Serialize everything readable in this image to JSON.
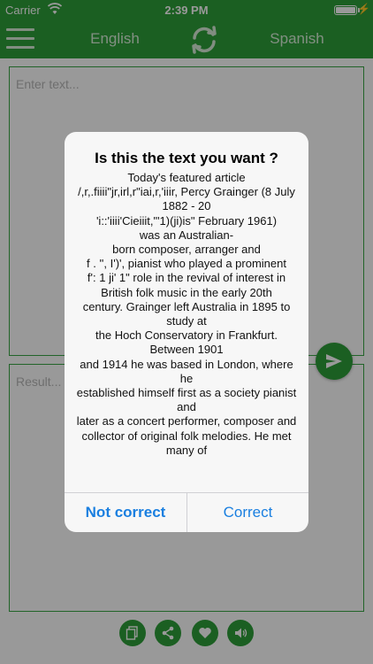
{
  "status_bar": {
    "carrier": "Carrier",
    "time": "2:39 PM"
  },
  "nav": {
    "source_language": "English",
    "target_language": "Spanish"
  },
  "input": {
    "placeholder": "Enter text..."
  },
  "result": {
    "placeholder": "Result..."
  },
  "alert": {
    "title": "Is this the text you want ?",
    "lines": [
      "Today's featured article",
      "/,r,.fiiii\"jr,irl,r\"iai,r,'iiir, Percy Grainger (8 July 1882 - 20",
      "'i::'iiii'Cieiiit,\"'1)(ji)is\" February 1961)",
      "was an Australian-",
      "born composer, arranger and",
      "f . '', I')', pianist who played a prominent",
      "f': 1 ji' 1\" role in the revival of interest in",
      "British folk music in the early 20th",
      "century. Grainger left Australia in 1895 to study at",
      "the Hoch Conservatory in Frankfurt. Between 1901",
      "and 1914 he was based in London, where he",
      "established himself first as a society pianist and",
      "later as a concert performer, composer and",
      "collector of original folk melodies. He met many of"
    ],
    "not_correct_label": "Not correct",
    "correct_label": "Correct"
  },
  "colors": {
    "primary_green": "#2e9e3a",
    "link_blue": "#1a7fe0"
  },
  "icons": {
    "menu": "hamburger-icon",
    "swap": "swap-languages-icon",
    "send": "send-icon",
    "copy": "copy-icon",
    "share": "share-icon",
    "favorite": "heart-icon",
    "speak": "speaker-icon"
  }
}
